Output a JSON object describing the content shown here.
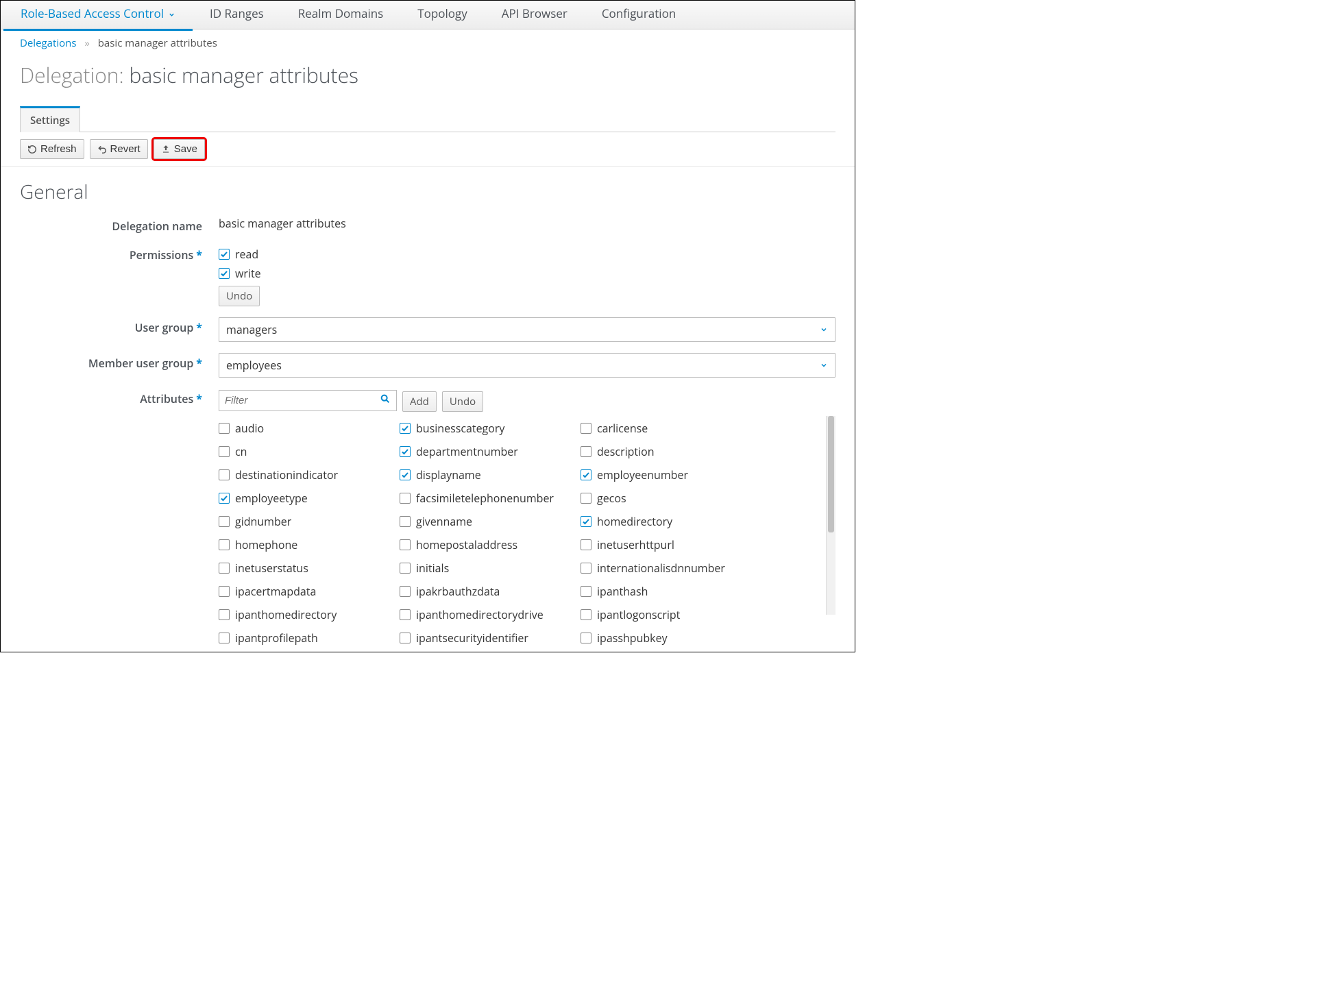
{
  "topnav": {
    "items": [
      {
        "label": "Role-Based Access Control",
        "active": true,
        "dropdown": true
      },
      {
        "label": "ID Ranges"
      },
      {
        "label": "Realm Domains"
      },
      {
        "label": "Topology"
      },
      {
        "label": "API Browser"
      },
      {
        "label": "Configuration"
      }
    ]
  },
  "breadcrumb": {
    "root": "Delegations",
    "current": "basic manager attributes"
  },
  "page_title_prefix": "Delegation: ",
  "page_title_value": "basic manager attributes",
  "tabs": {
    "settings": "Settings"
  },
  "toolbar": {
    "refresh": "Refresh",
    "revert": "Revert",
    "save": "Save",
    "save_highlighted": true
  },
  "section_general": "General",
  "labels": {
    "delegation_name": "Delegation name",
    "permissions": "Permissions",
    "user_group": "User group",
    "member_user_group": "Member user group",
    "attributes": "Attributes"
  },
  "values": {
    "delegation_name": "basic manager attributes",
    "user_group": "managers",
    "member_user_group": "employees"
  },
  "permissions": {
    "read": {
      "label": "read",
      "checked": true
    },
    "write": {
      "label": "write",
      "checked": true
    },
    "undo": "Undo"
  },
  "filter": {
    "placeholder": "Filter",
    "add": "Add",
    "undo": "Undo"
  },
  "attributes": [
    {
      "name": "audio",
      "checked": false
    },
    {
      "name": "businesscategory",
      "checked": true
    },
    {
      "name": "carlicense",
      "checked": false
    },
    {
      "name": "cn",
      "checked": false
    },
    {
      "name": "departmentnumber",
      "checked": true
    },
    {
      "name": "description",
      "checked": false
    },
    {
      "name": "destinationindicator",
      "checked": false
    },
    {
      "name": "displayname",
      "checked": true
    },
    {
      "name": "employeenumber",
      "checked": true
    },
    {
      "name": "employeetype",
      "checked": true
    },
    {
      "name": "facsimiletelephonenumber",
      "checked": false
    },
    {
      "name": "gecos",
      "checked": false
    },
    {
      "name": "gidnumber",
      "checked": false
    },
    {
      "name": "givenname",
      "checked": false
    },
    {
      "name": "homedirectory",
      "checked": true
    },
    {
      "name": "homephone",
      "checked": false
    },
    {
      "name": "homepostaladdress",
      "checked": false
    },
    {
      "name": "inetuserhttpurl",
      "checked": false
    },
    {
      "name": "inetuserstatus",
      "checked": false
    },
    {
      "name": "initials",
      "checked": false
    },
    {
      "name": "internationalisdnnumber",
      "checked": false
    },
    {
      "name": "ipacertmapdata",
      "checked": false
    },
    {
      "name": "ipakrbauthzdata",
      "checked": false
    },
    {
      "name": "ipanthash",
      "checked": false
    },
    {
      "name": "ipanthomedirectory",
      "checked": false
    },
    {
      "name": "ipanthomedirectorydrive",
      "checked": false
    },
    {
      "name": "ipantlogonscript",
      "checked": false
    },
    {
      "name": "ipantprofilepath",
      "checked": false
    },
    {
      "name": "ipantsecurityidentifier",
      "checked": false
    },
    {
      "name": "ipasshpubkey",
      "checked": false
    }
  ]
}
